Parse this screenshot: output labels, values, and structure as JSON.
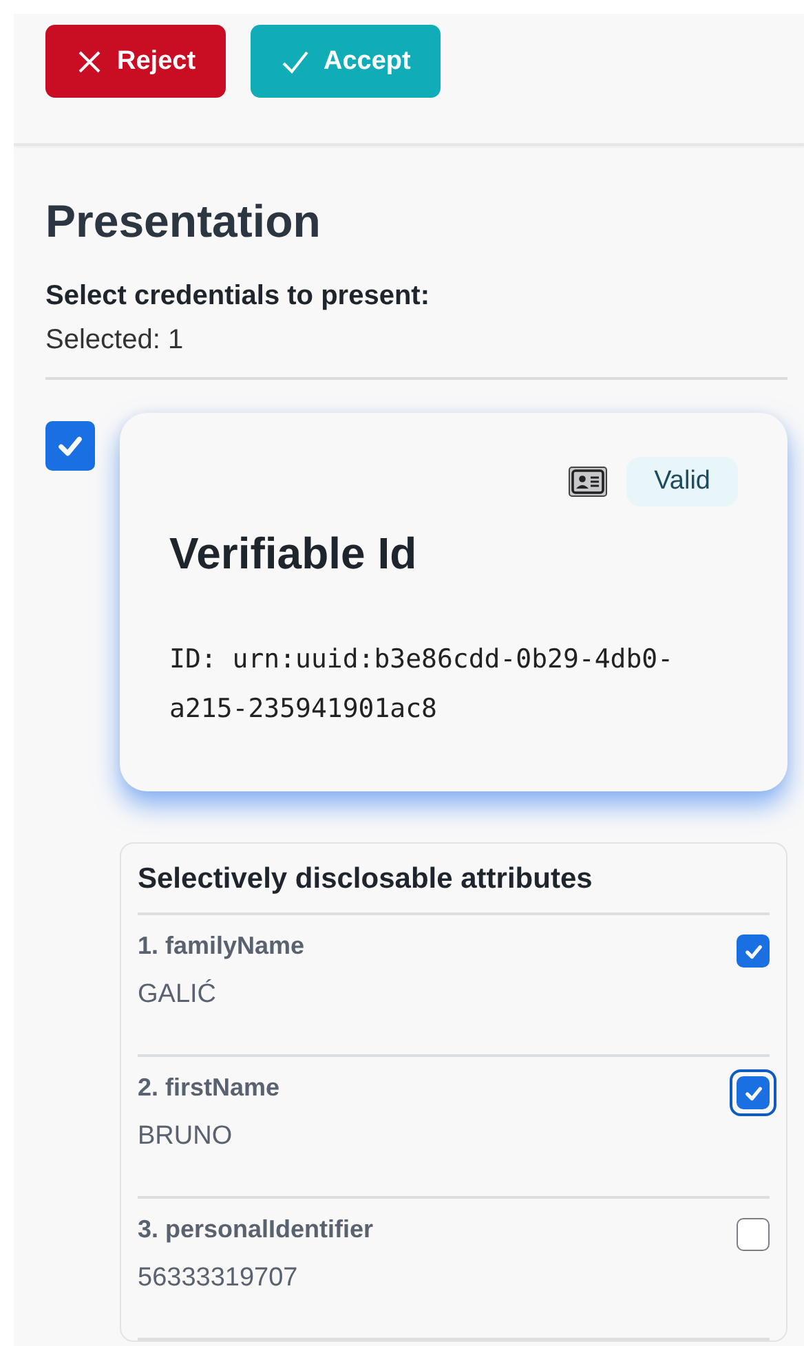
{
  "actions": [
    {
      "kind": "reject",
      "label": "Reject"
    },
    {
      "kind": "accept",
      "label": "Accept"
    }
  ],
  "title": "Presentation",
  "prompt": "Select credentials to present:",
  "selected_count": "Selected: 1",
  "credentials": [
    {
      "selected": true,
      "title": "Verifiable Id",
      "status": "Valid",
      "id_text": "ID: urn:uuid:b3e86cdd-0b29-4db0-a215-235941901ac8",
      "attributes_heading": "Selectively disclosable attributes",
      "attributes": [
        {
          "name": "1. familyName",
          "value": "GALIĆ",
          "checked": true,
          "focused": false
        },
        {
          "name": "2. firstName",
          "value": "BRUNO",
          "checked": true,
          "focused": true
        },
        {
          "name": "3. personalIdentifier",
          "value": "56333319707",
          "checked": false,
          "focused": false
        }
      ]
    }
  ]
}
